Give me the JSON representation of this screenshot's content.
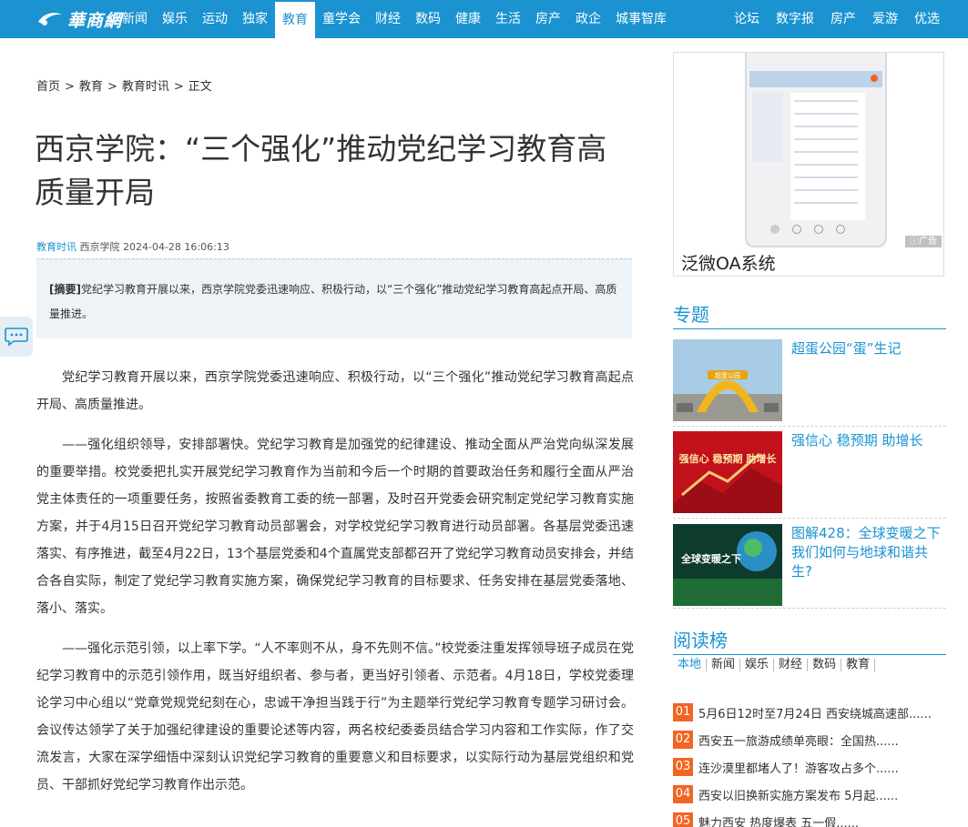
{
  "header": {
    "logo_text": "華商網",
    "nav_left": [
      "新闻",
      "娱乐",
      "运动",
      "独家",
      "教育",
      "童学会",
      "财经",
      "数码",
      "健康",
      "生活",
      "房产",
      "政企",
      "城事智库"
    ],
    "active": "教育",
    "nav_right": [
      "论坛",
      "数字报",
      "房产",
      "爱游",
      "优选"
    ],
    "accent_color": "#1a93d0"
  },
  "breadcrumb": [
    "首页",
    "教育",
    "教育时讯",
    "正文"
  ],
  "breadcrumb_sep": ">",
  "article": {
    "title": "西京学院：“三个强化”推动党纪学习教育高质量开局",
    "category": "教育时讯",
    "source": "西京学院",
    "datetime": "2024-04-28 16:06:13",
    "abstract_label": "[摘要]",
    "abstract": "党纪学习教育开展以来，西京学院党委迅速响应、积极行动，以“三个强化”推动党纪学习教育高起点开局、高质量推进。",
    "paragraphs": [
      "党纪学习教育开展以来，西京学院党委迅速响应、积极行动，以“三个强化”推动党纪学习教育高起点开局、高质量推进。",
      "——强化组织领导，安排部署快。党纪学习教育是加强党的纪律建设、推动全面从严治党向纵深发展的重要举措。校党委把扎实开展党纪学习教育作为当前和今后一个时期的首要政治任务和履行全面从严治党主体责任的一项重要任务，按照省委教育工委的统一部署，及时召开党委会研究制定党纪学习教育实施方案，并于4月15日召开党纪学习教育动员部署会，对学校党纪学习教育进行动员部署。各基层党委迅速落实、有序推进，截至4月22日，13个基层党委和4个直属党支部都召开了党纪学习教育动员安排会，并结合各自实际，制定了党纪学习教育实施方案，确保党纪学习教育的目标要求、任务安排在基层党委落地、落小、落实。",
      "——强化示范引领，以上率下学。“人不率则不从，身不先则不信。”校党委注重发挥领导班子成员在党纪学习教育中的示范引领作用，既当好组织者、参与者，更当好引领者、示范者。4月18日，学校党委理论学习中心组以“党章党规党纪刻在心，忠诚干净担当践于行”为主题举行党纪学习教育专题学习研讨会。会议传达领学了关于加强纪律建设的重要论述等内容，两名校纪委委员结合学习内容和工作实际，作了交流发言，大家在深学细悟中深刻认识党纪学习教育的重要意义和目标要求，以实际行动为基层党组织和党员、干部抓好党纪学习教育作出示范。"
    ]
  },
  "ad": {
    "title": "泛微OA系统",
    "label": "广告"
  },
  "topics": {
    "heading": "专题",
    "items": [
      {
        "title": "超蛋公园“蛋”生记",
        "image_text": "超蛋公园"
      },
      {
        "title": "强信心 稳预期 助增长",
        "image_text": "强信心 稳预期 助增长"
      },
      {
        "title": "图解428：全球变暖之下 我们如何与地球和谐共生?",
        "image_text": "全球变暖之下"
      }
    ]
  },
  "rank": {
    "heading": "阅读榜",
    "tabs": [
      "本地",
      "新闻",
      "娱乐",
      "财经",
      "数码",
      "教育"
    ],
    "active_tab": "本地",
    "items": [
      {
        "num": "01",
        "text": "5月6日12时至7月24日 西安绕城高速部......"
      },
      {
        "num": "02",
        "text": "西安五一旅游成绩单亮眼：全国热......"
      },
      {
        "num": "03",
        "text": "连沙漠里都堵人了！游客攻占多个......"
      },
      {
        "num": "04",
        "text": "西安以旧换新实施方案发布 5月起......"
      },
      {
        "num": "05",
        "text": "魅力西安 热度爆表 五一假......"
      }
    ]
  }
}
